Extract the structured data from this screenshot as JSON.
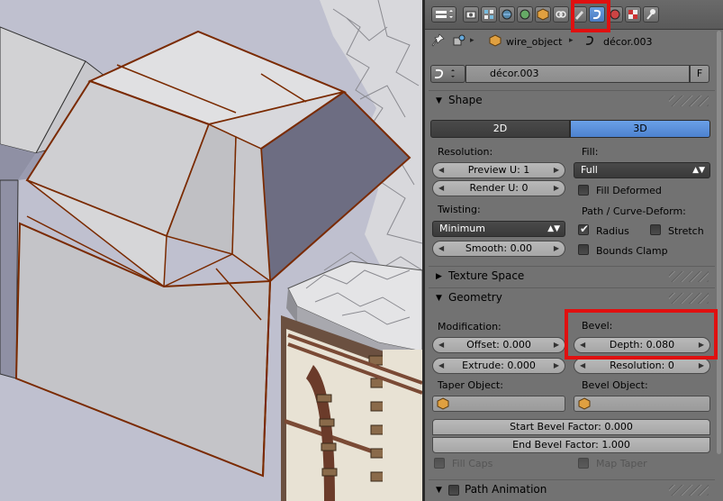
{
  "breadcrumb": {
    "object_name": "wire_object",
    "data_name": "décor.003"
  },
  "datablock": {
    "name": "décor.003",
    "fake_user": "F"
  },
  "panels": {
    "shape": {
      "title": "Shape",
      "dim_2d": "2D",
      "dim_3d": "3D",
      "dimension_selected": "3D",
      "resolution_label": "Resolution:",
      "preview_u": "Preview U: 1",
      "render_u": "Render U: 0",
      "fill_label": "Fill:",
      "fill_value": "Full",
      "fill_deformed": "Fill Deformed",
      "twisting_label": "Twisting:",
      "twisting_value": "Minimum",
      "smooth": "Smooth: 0.00",
      "path_curve_deform": "Path / Curve-Deform:",
      "radius": "Radius",
      "stretch": "Stretch",
      "bounds_clamp": "Bounds Clamp"
    },
    "texture_space": {
      "title": "Texture Space"
    },
    "geometry": {
      "title": "Geometry",
      "modification_label": "Modification:",
      "offset": "Offset: 0.000",
      "extrude": "Extrude: 0.000",
      "bevel_label": "Bevel:",
      "depth": "Depth: 0.080",
      "resolution": "Resolution: 0",
      "taper_object_label": "Taper Object:",
      "bevel_object_label": "Bevel Object:",
      "start_bevel_factor": "Start Bevel Factor: 0.000",
      "end_bevel_factor": "End Bevel Factor: 1.000",
      "fill_caps": "Fill Caps",
      "map_taper": "Map Taper"
    },
    "path_animation": {
      "title": "Path Animation"
    }
  },
  "checkboxes": {
    "fill_deformed": false,
    "radius": true,
    "stretch": false,
    "bounds_clamp": false,
    "fill_caps": false,
    "map_taper": false,
    "path_animation": false
  },
  "colors": {
    "accent_active": "#5a8fd6",
    "highlight_box": "#e01010",
    "panel_bg": "#727272",
    "viewport_bg": "#bfc0cf"
  },
  "icons": {
    "toolbar": [
      "editor-type-icon",
      "render-icon",
      "render-layers-icon",
      "scene-icon",
      "world-icon",
      "object-icon",
      "constraints-icon",
      "modifiers-icon",
      "curve-data-icon",
      "material-icon",
      "texture-icon",
      "physics-icon"
    ],
    "breadcrumb": [
      "pin-icon",
      "scene-data-icon",
      "object-icon",
      "curve-data-icon"
    ]
  }
}
